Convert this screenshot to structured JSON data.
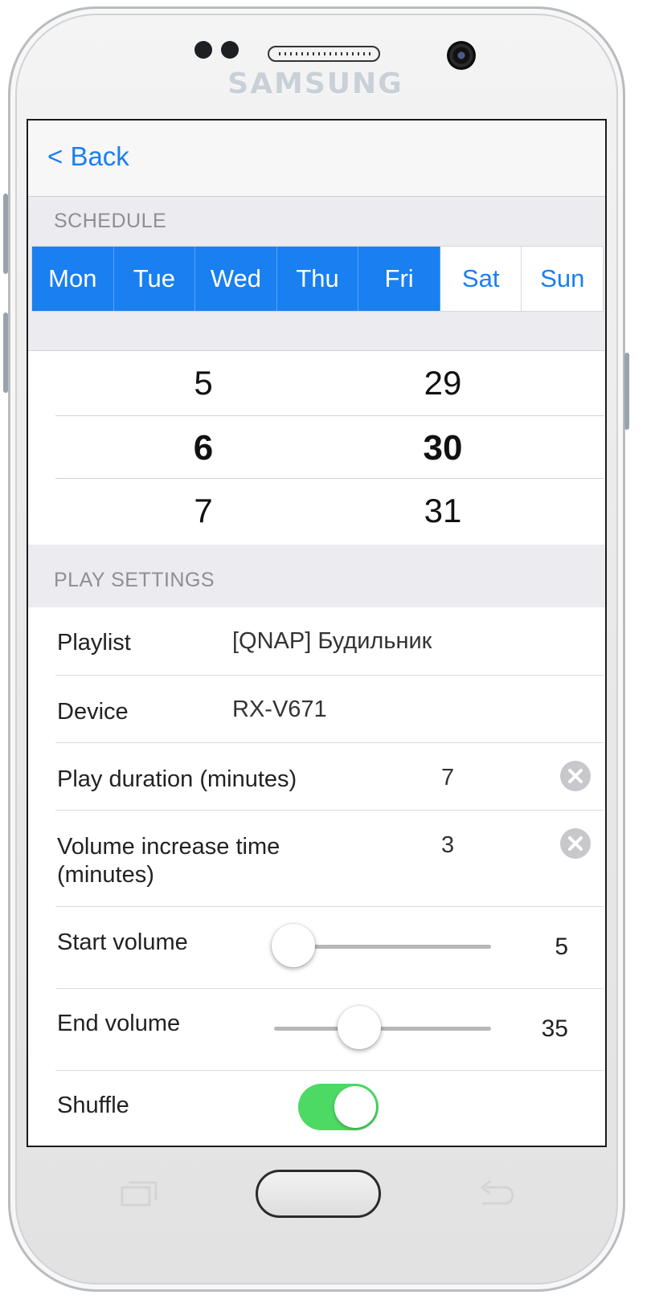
{
  "device": {
    "brand": "SAMSUNG",
    "frame_color": "#e9e9e9",
    "accent_color": "#1a7ff0"
  },
  "navbar": {
    "back_label": "< Back"
  },
  "schedule": {
    "section_title": "SCHEDULE",
    "days": [
      {
        "label": "Mon",
        "selected": true
      },
      {
        "label": "Tue",
        "selected": true
      },
      {
        "label": "Wed",
        "selected": true
      },
      {
        "label": "Thu",
        "selected": true
      },
      {
        "label": "Fri",
        "selected": true
      },
      {
        "label": "Sat",
        "selected": false
      },
      {
        "label": "Sun",
        "selected": false
      }
    ],
    "time_picker": {
      "hours": [
        "5",
        "6",
        "7"
      ],
      "minutes": [
        "29",
        "30",
        "31"
      ],
      "selected_hour": "6",
      "selected_minute": "30"
    }
  },
  "play_settings": {
    "section_title": "PLAY SETTINGS",
    "playlist": {
      "label": "Playlist",
      "value": "[QNAP] Будильник"
    },
    "device": {
      "label": "Device",
      "value": "RX-V671"
    },
    "play_duration": {
      "label": "Play duration (minutes)",
      "value": "7"
    },
    "volume_increase": {
      "label_line1": "Volume increase time",
      "label_line2": "(minutes)",
      "value": "3"
    },
    "start_volume": {
      "label": "Start volume",
      "value": "5",
      "fraction": 0.0
    },
    "end_volume": {
      "label": "End volume",
      "value": "35",
      "fraction": 0.38
    },
    "shuffle": {
      "label": "Shuffle",
      "on": true,
      "on_color": "#4cd964"
    }
  },
  "icons": {
    "clear": "clear-circle-icon",
    "recent_apps": "recent-apps-icon",
    "back": "back-arrow-icon"
  }
}
